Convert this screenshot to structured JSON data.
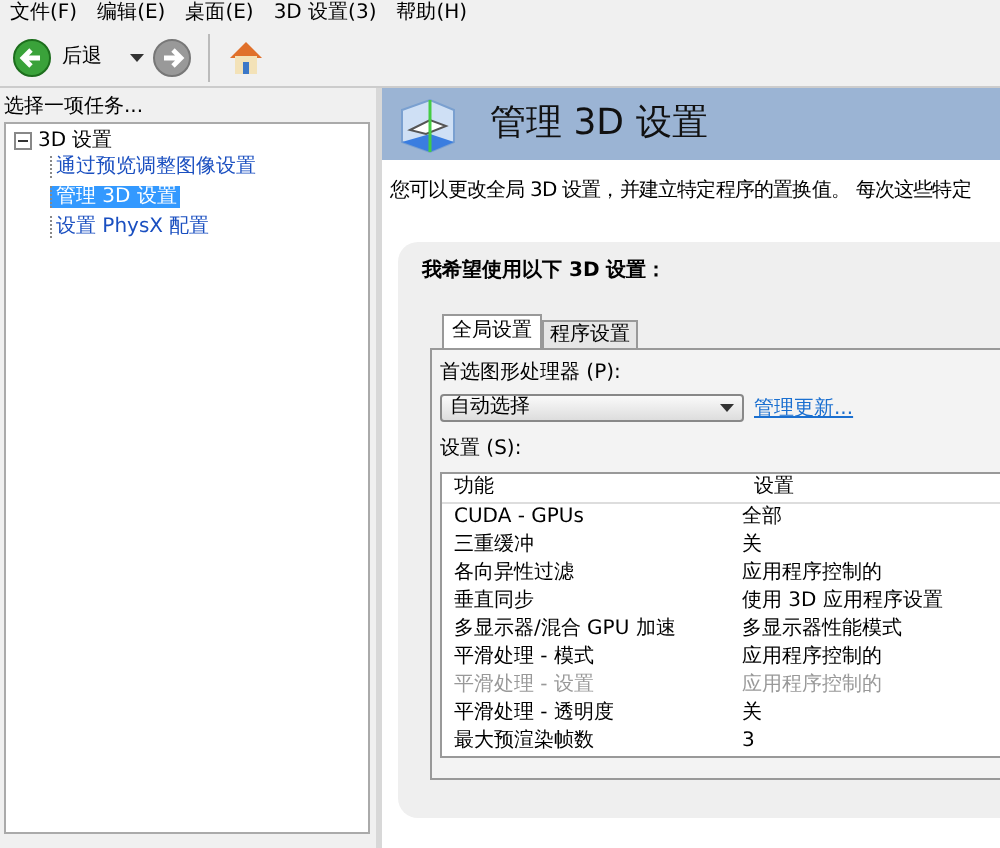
{
  "menu": [
    "文件(F)",
    "编辑(E)",
    "桌面(E)",
    "3D 设置(3)",
    "帮助(H)"
  ],
  "toolbar": {
    "back_label": "后退"
  },
  "sidebar": {
    "title": "选择一项任务...",
    "tree": [
      {
        "label": "3D 设置",
        "expanded": true,
        "children": [
          {
            "label": "通过预览调整图像设置",
            "selected": false
          },
          {
            "label": "管理 3D 设置",
            "selected": true
          },
          {
            "label": "设置 PhysX 配置",
            "selected": false
          }
        ]
      }
    ]
  },
  "page": {
    "title": "管理 3D 设置",
    "description": "您可以更改全局 3D 设置，并建立特定程序的置换值。 每次这些特定",
    "group_title": "我希望使用以下 3D 设置：",
    "tabs": [
      {
        "label": "全局设置",
        "selected": true
      },
      {
        "label": "程序设置",
        "selected": false
      }
    ],
    "gpu_label": "首选图形处理器 (P):",
    "gpu_value": "自动选择",
    "manage_link": "管理更新...",
    "settings_label": "设置 (S):",
    "columns": [
      "功能",
      "设置"
    ],
    "rows": [
      {
        "feature": "CUDA - GPUs",
        "value": "全部",
        "disabled": false
      },
      {
        "feature": "三重缓冲",
        "value": "关",
        "disabled": false
      },
      {
        "feature": "各向异性过滤",
        "value": "应用程序控制的",
        "disabled": false
      },
      {
        "feature": "垂直同步",
        "value": "使用 3D 应用程序设置",
        "disabled": false
      },
      {
        "feature": "多显示器/混合 GPU 加速",
        "value": "多显示器性能模式",
        "disabled": false
      },
      {
        "feature": "平滑处理 - 模式",
        "value": "应用程序控制的",
        "disabled": false
      },
      {
        "feature": "平滑处理 - 设置",
        "value": "应用程序控制的",
        "disabled": true
      },
      {
        "feature": "平滑处理 - 透明度",
        "value": "关",
        "disabled": false
      },
      {
        "feature": "最大预渲染帧数",
        "value": "3",
        "disabled": false
      }
    ]
  }
}
